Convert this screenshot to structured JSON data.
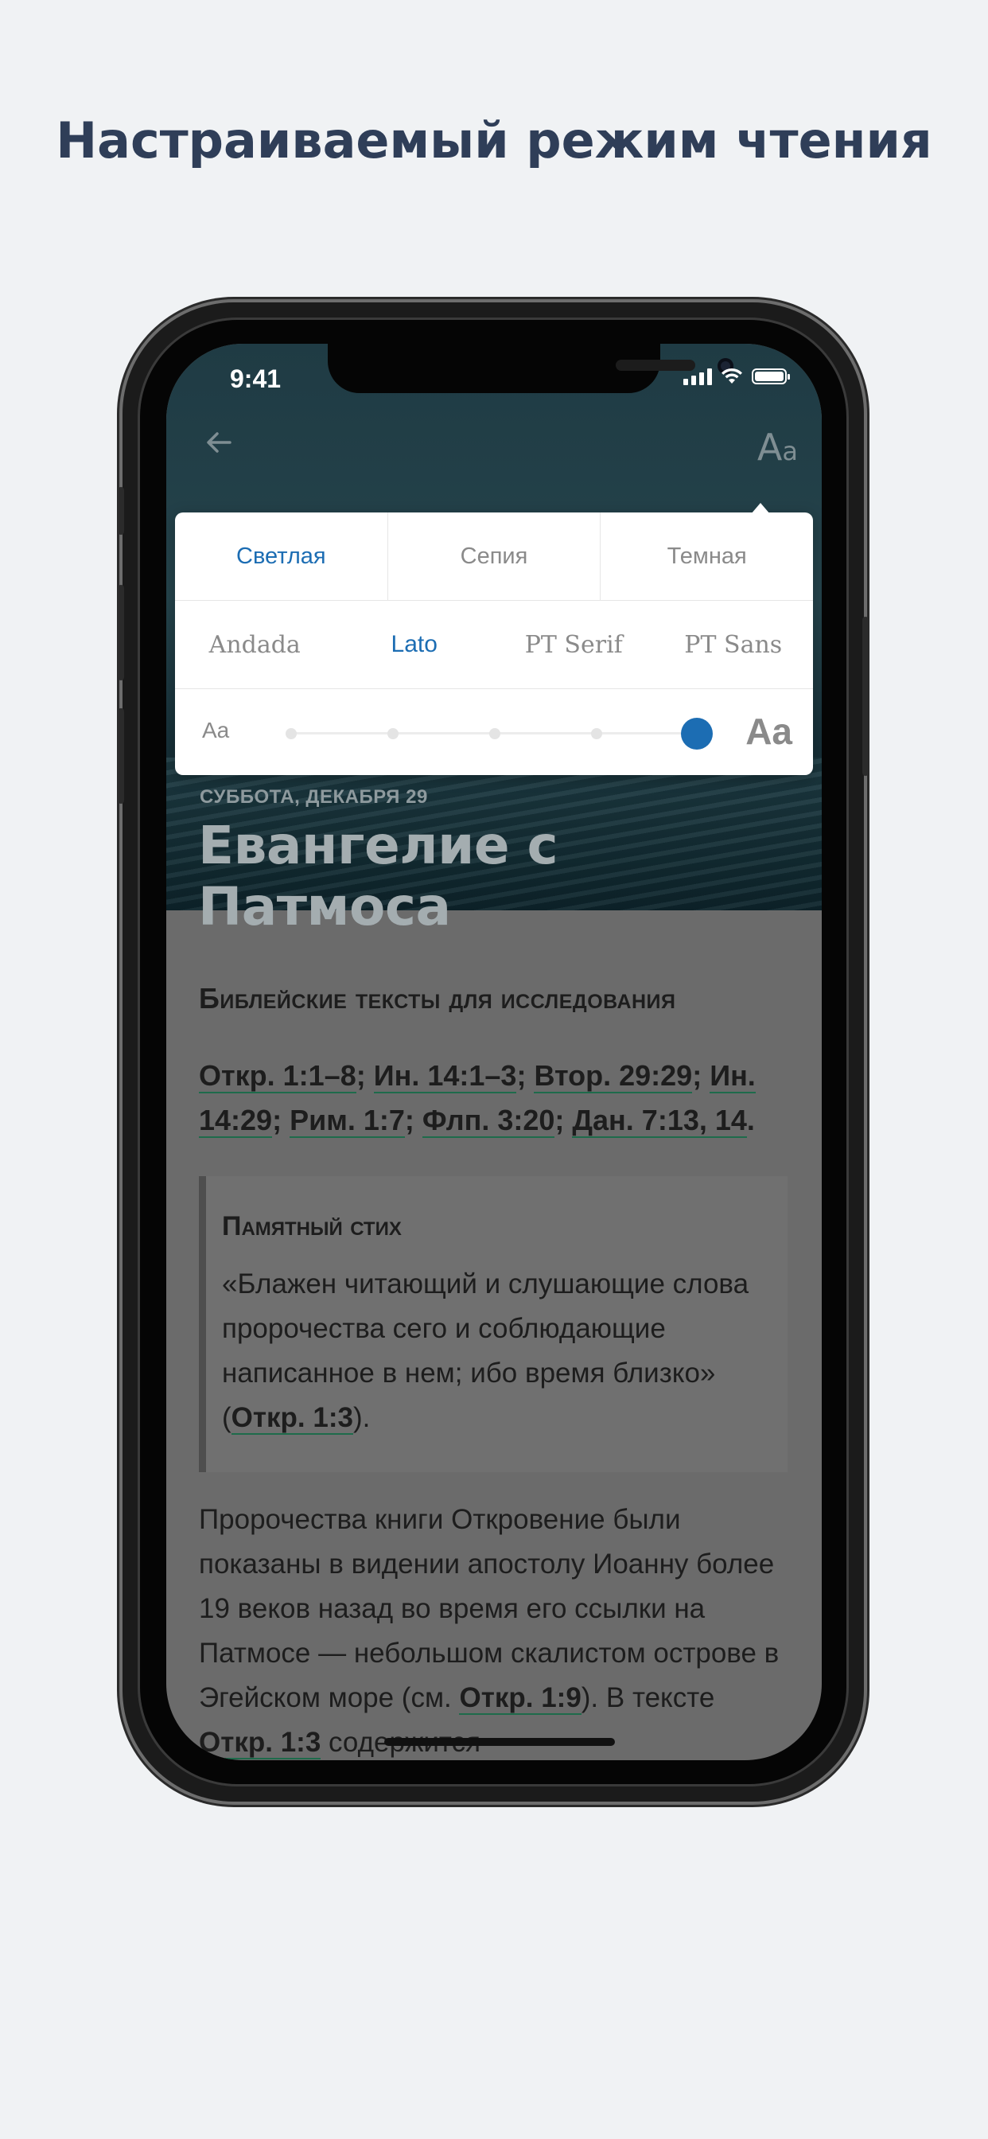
{
  "headline": "Настраиваемый режим чтения",
  "status_bar": {
    "time": "9:41"
  },
  "nav": {
    "back_icon": "arrow-left-icon",
    "font_settings_label": "Aa"
  },
  "settings": {
    "themes": [
      {
        "label": "Светлая",
        "active": true
      },
      {
        "label": "Сепия",
        "active": false
      },
      {
        "label": "Темная",
        "active": false
      }
    ],
    "fonts": [
      {
        "label": "Andada",
        "active": false
      },
      {
        "label": "Lato",
        "active": true
      },
      {
        "label": "PT Serif",
        "active": false
      },
      {
        "label": "PT Sans",
        "active": false
      }
    ],
    "size_small_label": "Aa",
    "size_large_label": "Aa",
    "size_steps": 5,
    "size_selected_step": 5,
    "accent_color": "#1c6db3"
  },
  "lesson": {
    "date": "СУББОТА, ДЕКАБРЯ 29",
    "title": "Евангелие с Патмоса",
    "section_title": "Библейские тексты для исследования",
    "refs": [
      "Откр. 1:1–8",
      "Ин. 14:1–3",
      "Втор. 29:29",
      "Ин. 14:29",
      "Рим. 1:7",
      "Флп. 3:20",
      "Дан. 7:13, 14"
    ],
    "memory_title": "Памятный стих",
    "memory_text": "«Блажен читающий и слушающие слова пророчества сего и соблюдающие написанное в нем; ибо время близко» (",
    "memory_ref": "Откр. 1:3",
    "memory_end": ").",
    "paragraph_start": "Пророчества книги Откровение были показаны в видении апостолу Иоанну более 19 веков назад во время его ссылки на Патмосе — небольшом скалистом острове в Эгейском море (см. ",
    "paragraph_ref1": "Откр. 1:9",
    "paragraph_mid": "). В тексте ",
    "paragraph_ref2": "Откр. 1:3",
    "paragraph_end": " содержится"
  }
}
